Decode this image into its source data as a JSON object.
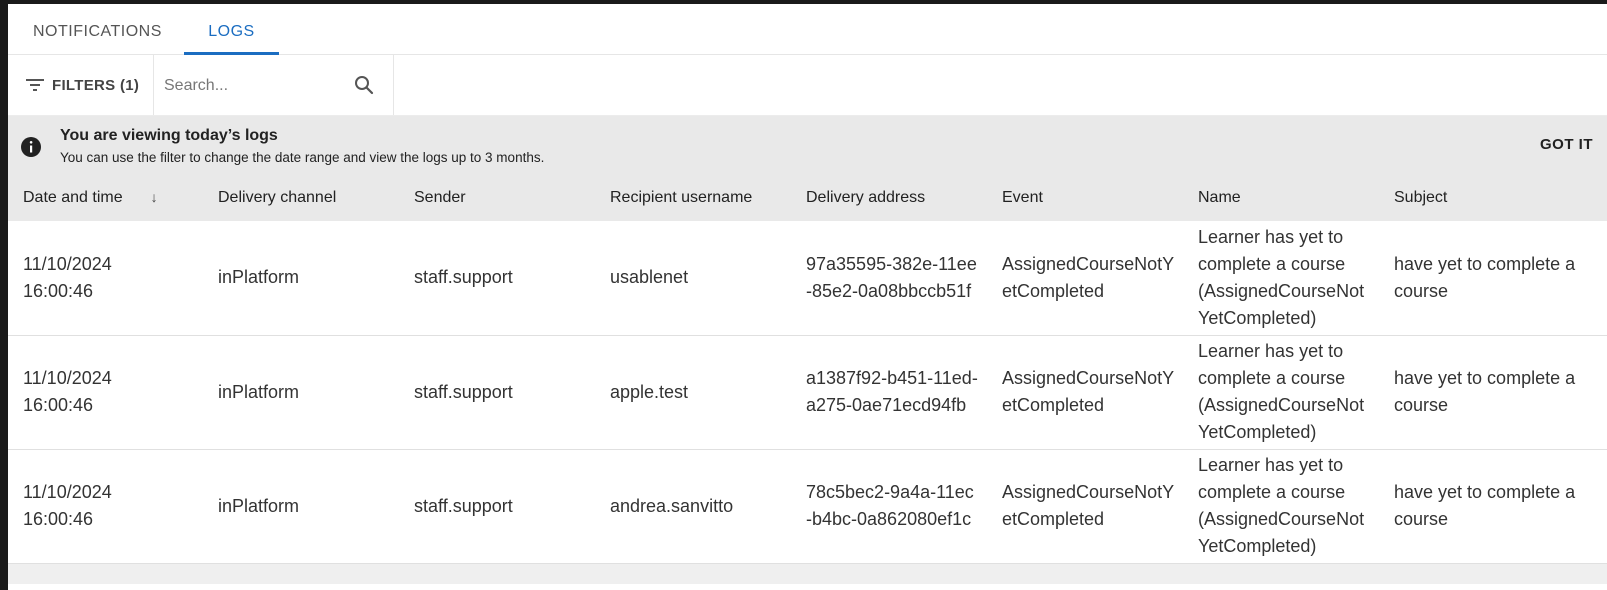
{
  "tabs": [
    {
      "label": "NOTIFICATIONS",
      "active": false
    },
    {
      "label": "LOGS",
      "active": true
    }
  ],
  "toolbar": {
    "filters_label": "FILTERS (1)",
    "search_placeholder": "Search..."
  },
  "banner": {
    "title": "You are viewing today’s logs",
    "text": "You can use the filter to change the date range and view the logs up to 3 months.",
    "dismiss_label": "GOT IT"
  },
  "table": {
    "columns": [
      "Date and time",
      "Delivery channel",
      "Sender",
      "Recipient username",
      "Delivery address",
      "Event",
      "Name",
      "Subject"
    ],
    "sort_indicator": "↓",
    "rows": [
      {
        "date": "11/10/2024",
        "time": "16:00:46",
        "channel": "inPlatform",
        "sender": "staff.support",
        "recipient": "usablenet",
        "address": "97a35595-382e-11ee-85e2-0a08bbccb51f",
        "event": "AssignedCourseNotYetCompleted",
        "name": "Learner has yet to complete a course (AssignedCourseNotYetCompleted)",
        "subject": "have yet to complete a course"
      },
      {
        "date": "11/10/2024",
        "time": "16:00:46",
        "channel": "inPlatform",
        "sender": "staff.support",
        "recipient": "apple.test",
        "address": "a1387f92-b451-11ed-a275-0ae71ecd94fb",
        "event": "AssignedCourseNotYetCompleted",
        "name": "Learner has yet to complete a course (AssignedCourseNotYetCompleted)",
        "subject": "have yet to complete a course"
      },
      {
        "date": "11/10/2024",
        "time": "16:00:46",
        "channel": "inPlatform",
        "sender": "staff.support",
        "recipient": "andrea.sanvitto",
        "address": "78c5bec2-9a4a-11ec-b4bc-0a862080ef1c",
        "event": "AssignedCourseNotYetCompleted",
        "name": "Learner has yet to complete a course (AssignedCourseNotYetCompleted)",
        "subject": "have yet to complete a course"
      }
    ]
  },
  "colors": {
    "accent": "#1b6dc1",
    "banner_bg": "#e9e9e9"
  },
  "icons": {
    "filters": "filter-icon",
    "search": "search-icon",
    "info": "info-icon",
    "sort": "arrow-down-icon"
  }
}
